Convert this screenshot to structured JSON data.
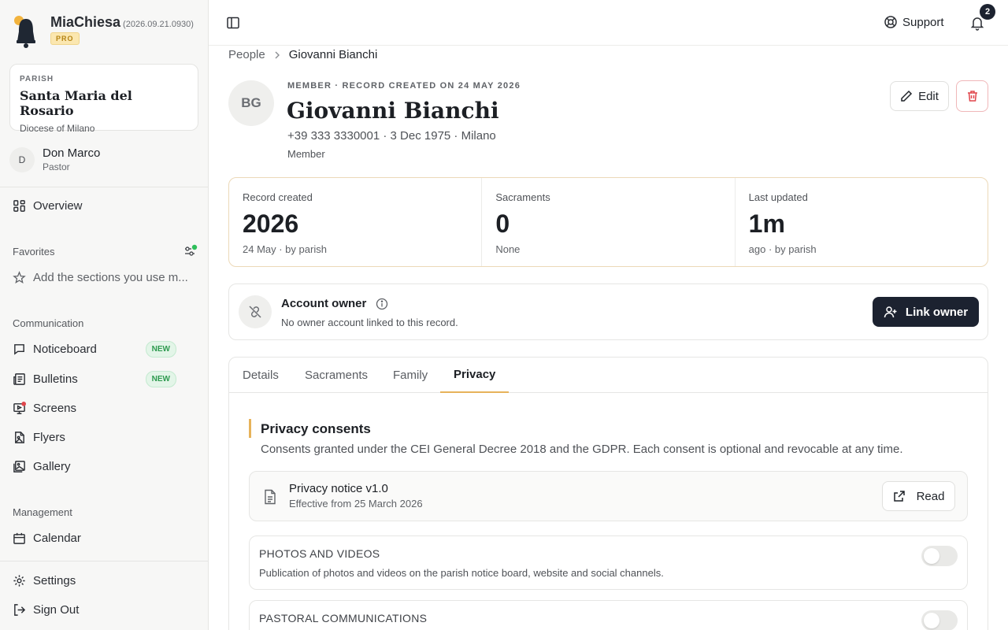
{
  "brand": {
    "name": "MiaChiesa",
    "version": "(2026.09.21.0930)",
    "badge": "PRO"
  },
  "parish": {
    "label": "PARISH",
    "name": "Santa Maria del Rosario",
    "diocese": "Diocese of Milano"
  },
  "user": {
    "initial": "D",
    "name": "Don Marco",
    "role": "Pastor"
  },
  "nav": {
    "overview": "Overview",
    "favorites_title": "Favorites",
    "favorites_hint": "Add the sections you use m...",
    "communication_title": "Communication",
    "noticeboard": "Noticeboard",
    "bulletins": "Bulletins",
    "screens": "Screens",
    "flyers": "Flyers",
    "gallery": "Gallery",
    "new_badge": "NEW",
    "management_title": "Management",
    "calendar": "Calendar",
    "settings": "Settings",
    "sign_out": "Sign Out"
  },
  "topbar": {
    "support": "Support",
    "notification_count": "2"
  },
  "breadcrumb": {
    "parent": "People",
    "current": "Giovanni Bianchi"
  },
  "person": {
    "initials": "BG",
    "eyebrow": "MEMBER · RECORD CREATED ON 24 MAY 2026",
    "name": "Giovanni Bianchi",
    "details": "+39 333 3330001 · 3 Dec 1975 · Milano",
    "role": "Member"
  },
  "actions": {
    "edit": "Edit"
  },
  "stats": [
    {
      "label": "Record created",
      "value": "2026",
      "sub": "24 May · by parish"
    },
    {
      "label": "Sacraments",
      "value": "0",
      "sub": "None"
    },
    {
      "label": "Last updated",
      "value": "1m",
      "sub": "ago · by parish"
    }
  ],
  "owner": {
    "title": "Account owner",
    "subtitle": "No owner account linked to this record.",
    "button": "Link owner"
  },
  "tabs": [
    "Details",
    "Sacraments",
    "Family",
    "Privacy"
  ],
  "privacy": {
    "title": "Privacy consents",
    "description": "Consents granted under the CEI General Decree 2018 and the GDPR. Each consent is optional and revocable at any time.",
    "notice_title": "Privacy notice v1.0",
    "notice_sub": "Effective from 25 March 2026",
    "read": "Read",
    "consents": [
      {
        "title": "PHOTOS AND VIDEOS",
        "desc": "Publication of photos and videos on the parish notice board, website and social channels.",
        "enabled": false
      },
      {
        "title": "PASTORAL COMMUNICATIONS",
        "desc": "",
        "enabled": false
      }
    ]
  },
  "colors": {
    "accent": "#e7b35a",
    "danger": "#e0464c",
    "dark": "#1c2230",
    "green": "#2fbf5b"
  }
}
